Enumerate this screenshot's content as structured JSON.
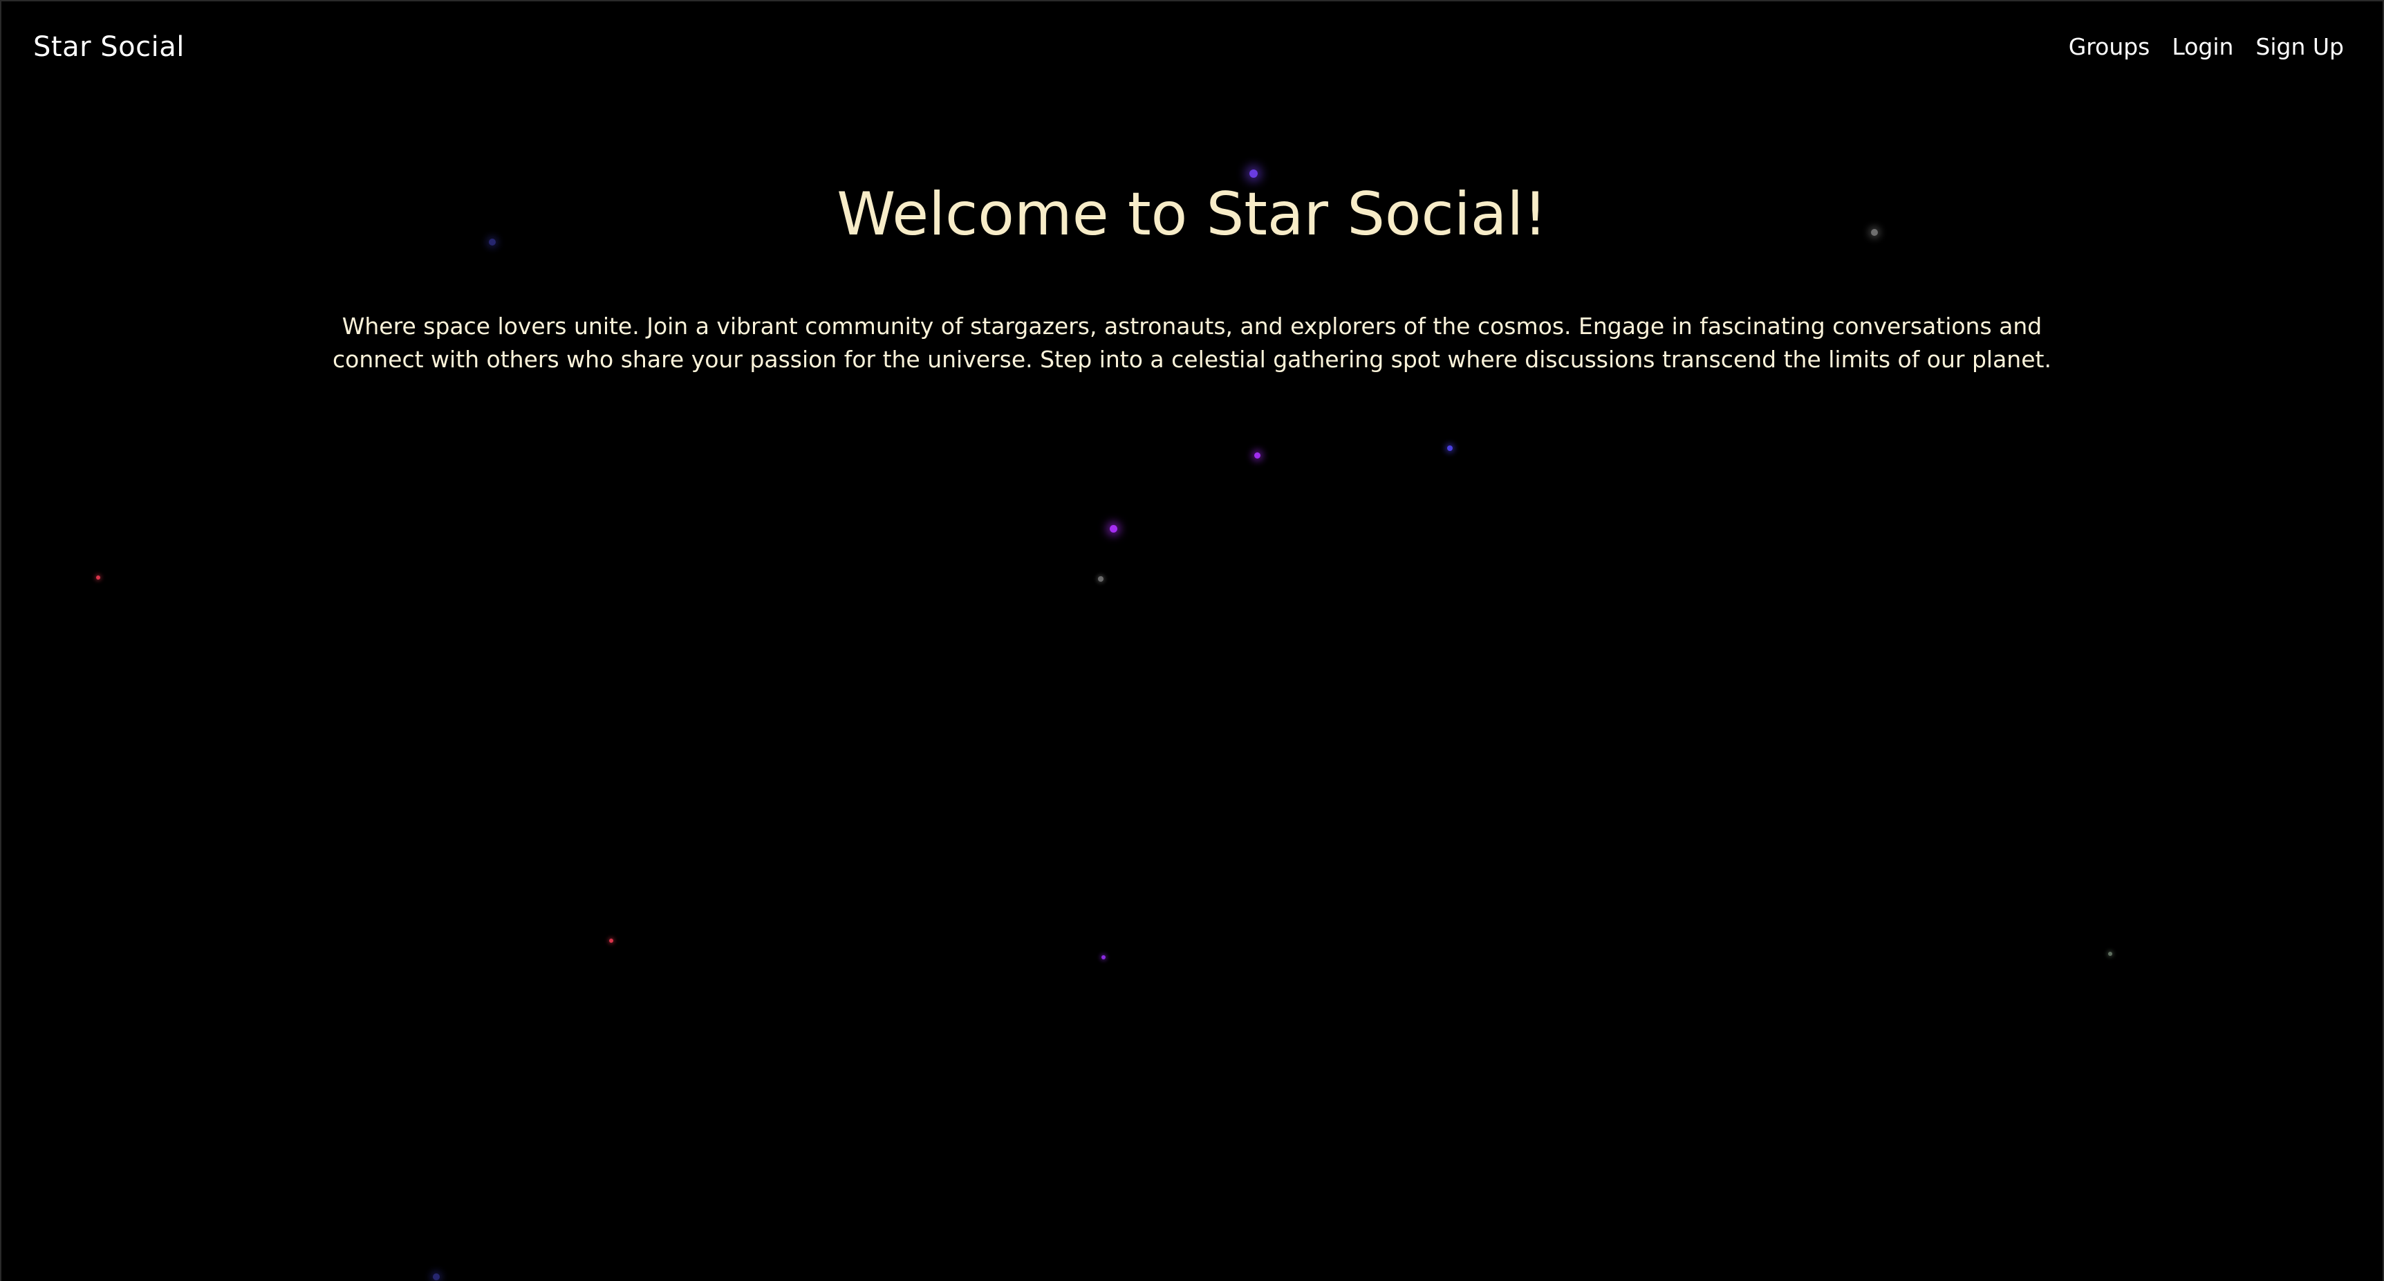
{
  "navbar": {
    "brand": "Star Social",
    "links": [
      "Groups",
      "Login",
      "Sign Up"
    ]
  },
  "hero": {
    "title": "Welcome to Star Social!",
    "description": "Where space lovers unite. Join a vibrant community of stargazers, astronauts, and explorers of the cosmos. Engage in fascinating conversations and connect with others who share your passion for the universe. Step into a celestial gathering spot where discussions transcend the limits of our planet."
  },
  "colors": {
    "background": "#000000",
    "title": "#f7ecc8",
    "text": "#fbf3da",
    "star_purple": "#9b3cf0",
    "star_blue": "#4a4ad8",
    "star_red": "#d8344a",
    "star_grey": "#7a7a7a"
  }
}
